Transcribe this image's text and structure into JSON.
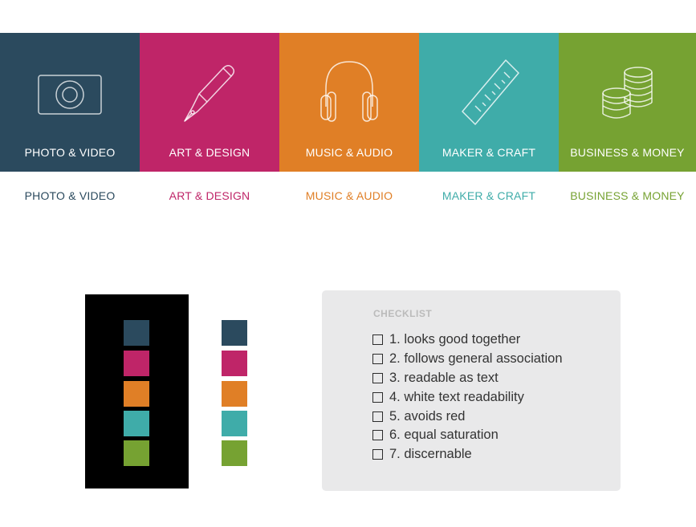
{
  "colors": {
    "navy": "#2b4a5e",
    "magenta": "#bf2568",
    "orange": "#e07f26",
    "teal": "#3faca9",
    "green": "#76a232"
  },
  "categories": [
    {
      "label": "PHOTO & VIDEO",
      "color": "#2b4a5e",
      "icon": "camera-icon"
    },
    {
      "label": "ART & DESIGN",
      "color": "#bf2568",
      "icon": "pen-icon"
    },
    {
      "label": "MUSIC & AUDIO",
      "color": "#e07f26",
      "icon": "headphones-icon"
    },
    {
      "label": "MAKER & CRAFT",
      "color": "#3faca9",
      "icon": "ruler-icon"
    },
    {
      "label": "BUSINESS & MONEY",
      "color": "#76a232",
      "icon": "coins-icon"
    }
  ],
  "checklist": {
    "title": "CHECKLIST",
    "items": [
      "1. looks good together",
      "2. follows general association",
      "3. readable as text",
      "4. white text readability",
      "5. avoids red",
      "6. equal saturation",
      "7. discernable"
    ]
  }
}
